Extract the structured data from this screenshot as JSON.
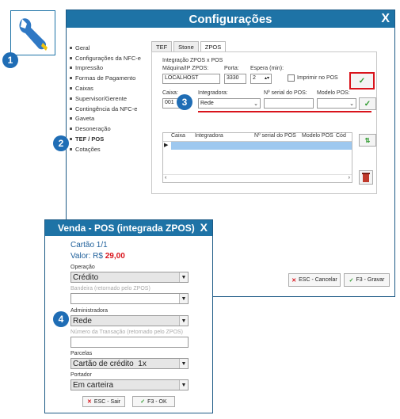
{
  "badges": {
    "b1": "1",
    "b2": "2",
    "b3": "3",
    "b4": "4"
  },
  "config": {
    "title": "Configurações",
    "close_label": "X",
    "menu": [
      {
        "label": "Geral"
      },
      {
        "label": "Configurações da NFC-e"
      },
      {
        "label": "Impressão"
      },
      {
        "label": "Formas de Pagamento"
      },
      {
        "label": "Caixas"
      },
      {
        "label": "Supervisor/Gerente"
      },
      {
        "label": "Contingência da NFC-e"
      },
      {
        "label": "Gaveta"
      },
      {
        "label": "Desoneração"
      },
      {
        "label": "TEF / POS"
      },
      {
        "label": "Cotações"
      }
    ],
    "tabs": [
      "TEF",
      "Stone",
      "ZPOS"
    ],
    "group_title": "Integração ZPOS x POS",
    "maquina_label": "Máquina/IP ZPOS:",
    "maquina_value": "LOCALHOST",
    "porta_label": "Porta:",
    "porta_value": "3330",
    "espera_label": "Espera (min):",
    "espera_value": "2",
    "imprimir_label": "Imprimir no POS",
    "caixa_label": "Caixa:",
    "caixa_value": "001",
    "integradora_label": "Integradora:",
    "integradora_value": "Rede",
    "serial_label": "Nº serial do POS:",
    "serial_value": "",
    "modelo_label": "Modelo POS:",
    "modelo_value": "",
    "grid_headers": [
      "Caixa",
      "Integradora",
      "Nº serial do POS",
      "Modelo POS",
      "Cód"
    ],
    "esc_label": "ESC - Cancelar",
    "f3_label": "F3 - Gravar"
  },
  "venda": {
    "title": "Venda - POS (integrada ZPOS)",
    "close_label": "X",
    "cartao": "Cartão 1/1",
    "valor_label": "Valor: R$",
    "valor_value": "29,00",
    "operacao_label": "Operação",
    "operacao_value": "Crédito",
    "bandeira_label": "Bandeira (retornado pelo ZPOS)",
    "bandeira_value": "",
    "administradora_label": "Administradora",
    "administradora_value": "Rede",
    "transacao_label": "Número da Transação (retornado pelo ZPOS)",
    "transacao_value": "",
    "parcelas_label": "Parcelas",
    "parcelas_value": "Cartão de crédito  1x",
    "portador_label": "Portador",
    "portador_value": "Em carteira",
    "esc_label": "ESC - Sair",
    "ok_label": "F3 - OK"
  },
  "colors": {
    "accent": "#1e73a6",
    "badge": "#1f6db5",
    "highlight": "#d9141c",
    "valor": "#d9141c",
    "ok": "#2e9a2e"
  }
}
